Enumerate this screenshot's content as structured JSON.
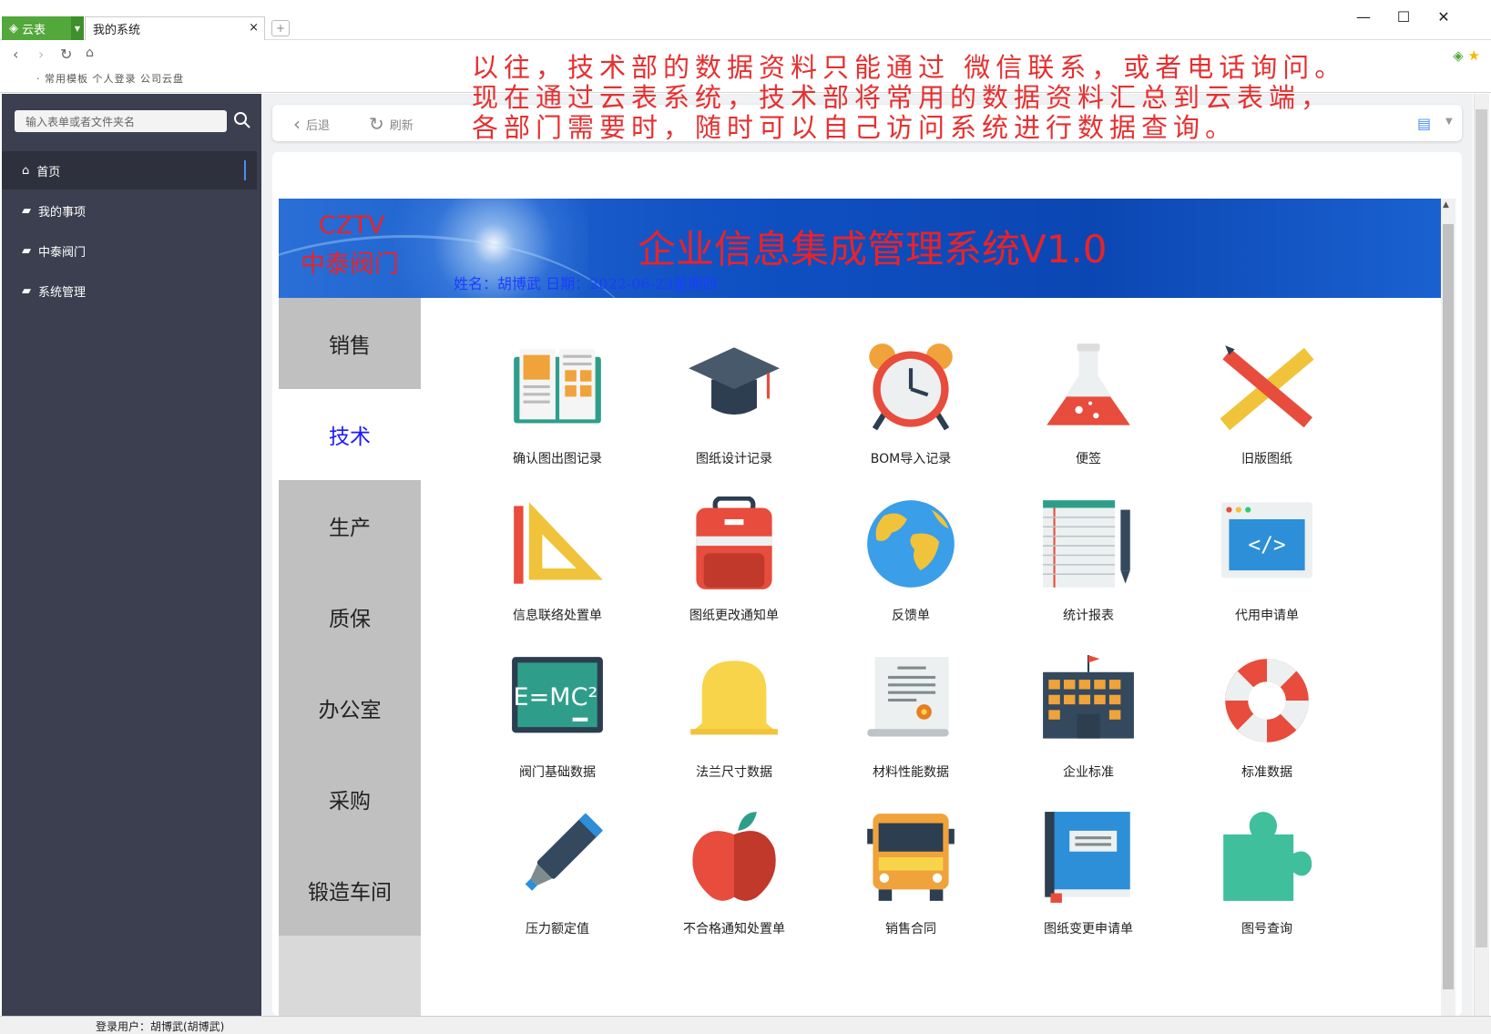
{
  "browser": {
    "app_tab": "云表",
    "page_tab": "我的系统",
    "close": "×",
    "new_tab": "+",
    "nav_links": "· 常用模板   个人登录   公司云盘",
    "window_controls": [
      "—",
      "☐",
      "✕"
    ]
  },
  "sidebar": {
    "search_placeholder": "输入表单或者文件夹名",
    "items": [
      {
        "label": "首页",
        "icon": "home-icon"
      },
      {
        "label": "我的事项",
        "icon": "folder-icon"
      },
      {
        "label": "中泰阀门",
        "icon": "folder-icon"
      },
      {
        "label": "系统管理",
        "icon": "folder-icon"
      }
    ]
  },
  "toolbar": {
    "back": "后退",
    "refresh": "刷新"
  },
  "annotation": [
    "以往，技术部的数据资料只能通过 微信联系，或者电话询问。",
    "现在通过云表系统，技术部将常用的数据资料汇总到云表端，",
    "各部门需要时，随时可以自己访问系统进行数据查询。"
  ],
  "banner": {
    "brand_en": "CZTV",
    "brand_cn": "中泰阀门",
    "title": "企业信息集成管理系统V1.0",
    "user_line": "姓名：胡博武    日期：2022-06-23星期四"
  },
  "departments": [
    {
      "label": "销售",
      "selected": false
    },
    {
      "label": "技术",
      "selected": true
    },
    {
      "label": "生产",
      "selected": false
    },
    {
      "label": "质保",
      "selected": false
    },
    {
      "label": "办公室",
      "selected": false
    },
    {
      "label": "采购",
      "selected": false
    },
    {
      "label": "锻造车间",
      "selected": false
    }
  ],
  "tiles": [
    {
      "label": "确认图出图记录",
      "icon": "book-icon"
    },
    {
      "label": "图纸设计记录",
      "icon": "graduation-cap-icon"
    },
    {
      "label": "BOM导入记录",
      "icon": "alarm-clock-icon"
    },
    {
      "label": "便签",
      "icon": "flask-icon"
    },
    {
      "label": "旧版图纸",
      "icon": "pencil-ruler-icon"
    },
    {
      "label": "信息联络处置单",
      "icon": "set-square-icon"
    },
    {
      "label": "图纸更改通知单",
      "icon": "backpack-icon"
    },
    {
      "label": "反馈单",
      "icon": "globe-icon"
    },
    {
      "label": "统计报表",
      "icon": "notepad-pen-icon"
    },
    {
      "label": "代用申请单",
      "icon": "code-window-icon"
    },
    {
      "label": "阀门基础数据",
      "icon": "blackboard-icon"
    },
    {
      "label": "法兰尺寸数据",
      "icon": "bell-icon"
    },
    {
      "label": "材料性能数据",
      "icon": "certificate-icon"
    },
    {
      "label": "企业标准",
      "icon": "building-icon"
    },
    {
      "label": "标准数据",
      "icon": "lifebuoy-icon"
    },
    {
      "label": "压力额定值",
      "icon": "marker-icon"
    },
    {
      "label": "不合格通知处置单",
      "icon": "apple-icon"
    },
    {
      "label": "销售合同",
      "icon": "bus-icon"
    },
    {
      "label": "图纸变更申请单",
      "icon": "blue-book-icon"
    },
    {
      "label": "图号查询",
      "icon": "puzzle-icon"
    }
  ],
  "status": {
    "user": "登录用户：胡博武(胡博武)"
  },
  "colors": {
    "sidebar": "#3b3f4f",
    "accent_green": "#52a83a",
    "banner_blue": "#0f50c2",
    "title_red": "#e8232a",
    "annotation_red": "#e53030",
    "selected_dept": "#1a1aff"
  }
}
